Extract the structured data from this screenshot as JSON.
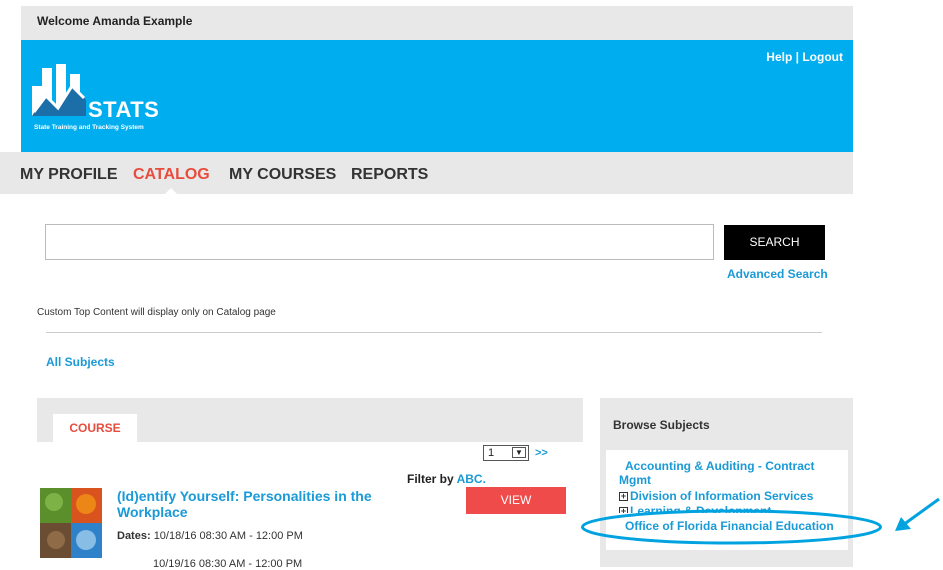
{
  "header": {
    "welcome": "Welcome Amanda Example",
    "help": "Help",
    "separator": " | ",
    "logout": "Logout"
  },
  "logo": {
    "word": "STATS",
    "subtitle": "State Training and Tracking System"
  },
  "nav": {
    "items": [
      "MY PROFILE",
      "CATALOG",
      "MY COURSES",
      "REPORTS"
    ],
    "active": "CATALOG"
  },
  "search": {
    "value": "",
    "button": "SEARCH",
    "advanced": "Advanced Search"
  },
  "custom_top_content": "Custom Top Content will display only on Catalog page",
  "all_subjects": "All Subjects",
  "course_panel": {
    "tab": "COURSE",
    "page_value": "1",
    "next": ">>",
    "filter_label": "Filter by ",
    "filter_link": "ABC.",
    "view_button": "VIEW",
    "course_title": "(Id)entify Yourself: Personalities in the Workplace",
    "dates_label": "Dates:",
    "date1": "10/18/16 08:30 AM - 12:00 PM",
    "date2": "10/19/16 08:30 AM - 12:00 PM"
  },
  "browse": {
    "title": "Browse Subjects",
    "items": [
      "Accounting & Auditing - Contract",
      "Mgmt",
      "Division of Information Services",
      "Learning & Development",
      "Office of Florida Financial Education"
    ]
  },
  "colors": {
    "banner": "#00aeef",
    "accent_red": "#e84c3d",
    "link_blue": "#1a9ad6",
    "annotation": "#00a3e0"
  }
}
